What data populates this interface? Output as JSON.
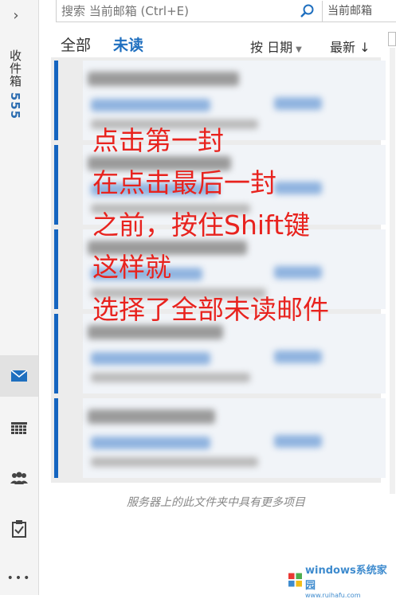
{
  "search": {
    "placeholder": "搜索 当前邮箱 (Ctrl+E)",
    "scope": "当前邮箱"
  },
  "rail": {
    "expand_glyph": "›",
    "folder_name": "收件箱",
    "folder_count": "555",
    "nav": [
      {
        "name": "mail",
        "icon": "mail-icon"
      },
      {
        "name": "calendar",
        "icon": "calendar-icon"
      },
      {
        "name": "people",
        "icon": "people-icon"
      },
      {
        "name": "tasks",
        "icon": "tasks-icon"
      },
      {
        "name": "more",
        "icon": "more-icon"
      }
    ],
    "more_label": "•••"
  },
  "filters": {
    "all": "全部",
    "unread": "未读",
    "sort_by": "按 日期",
    "order": "最新 ↓"
  },
  "annotation": {
    "lines": [
      "点击第一封",
      "在点击最后一封",
      "之前，按住Shift键",
      "这样就",
      "选择了全部未读邮件"
    ]
  },
  "footer": {
    "server_note": "服务器上的此文件夹中具有更多项目"
  },
  "watermark": {
    "main": "windows系统家园",
    "sub": "www.ruihafu.com"
  },
  "colors": {
    "accent": "#1f6fbf",
    "unread_bar": "#1565c0",
    "annotation": "#e8231e"
  }
}
